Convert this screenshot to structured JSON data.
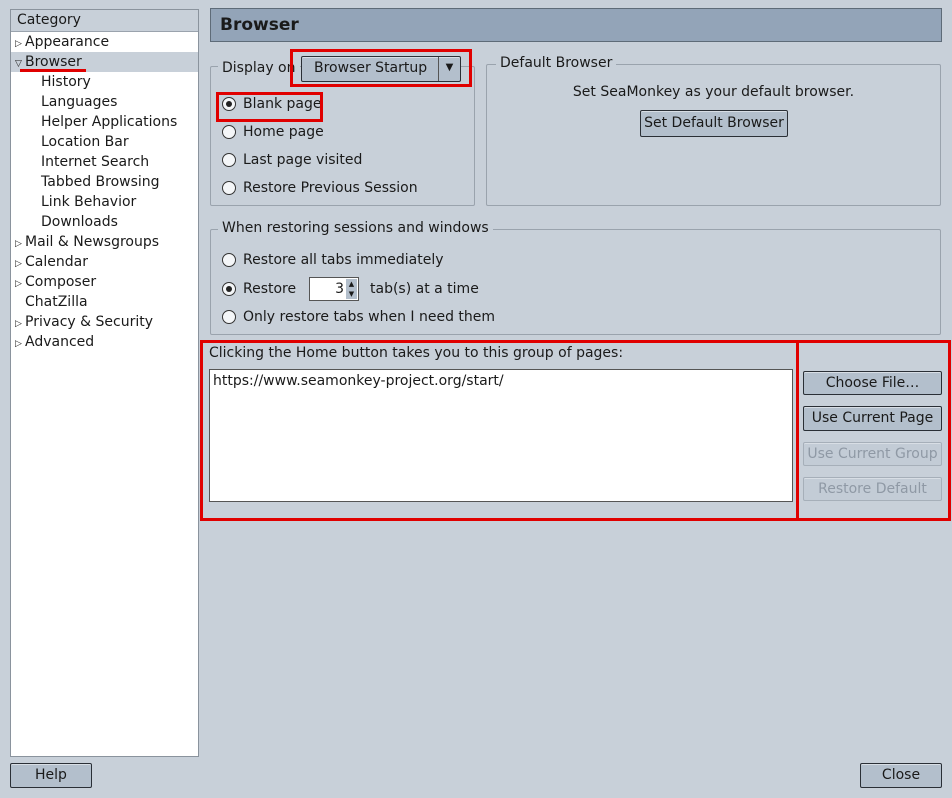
{
  "sidebar": {
    "header": "Category",
    "items": [
      {
        "label": "Appearance",
        "state": "collapsed"
      },
      {
        "label": "Browser",
        "state": "expanded",
        "selected": true
      },
      {
        "label": "History"
      },
      {
        "label": "Languages"
      },
      {
        "label": "Helper Applications"
      },
      {
        "label": "Location Bar"
      },
      {
        "label": "Internet Search"
      },
      {
        "label": "Tabbed Browsing"
      },
      {
        "label": "Link Behavior"
      },
      {
        "label": "Downloads"
      },
      {
        "label": "Mail & Newsgroups",
        "state": "collapsed"
      },
      {
        "label": "Calendar",
        "state": "collapsed"
      },
      {
        "label": "Composer",
        "state": "collapsed"
      },
      {
        "label": "ChatZilla"
      },
      {
        "label": "Privacy & Security",
        "state": "collapsed"
      },
      {
        "label": "Advanced",
        "state": "collapsed"
      }
    ]
  },
  "page_title": "Browser",
  "display_on": {
    "label": "Display on",
    "selected": "Browser Startup",
    "options": [
      {
        "label": "Blank page",
        "checked": true
      },
      {
        "label": "Home page",
        "checked": false
      },
      {
        "label": "Last page visited",
        "checked": false
      },
      {
        "label": "Restore Previous Session",
        "checked": false
      }
    ]
  },
  "default_browser": {
    "legend": "Default Browser",
    "text": "Set SeaMonkey as your default browser.",
    "button": "Set Default Browser"
  },
  "restore": {
    "legend": "When restoring sessions and windows",
    "opt1": "Restore all tabs immediately",
    "opt2_pre": "Restore",
    "opt2_value": "3",
    "opt2_post": "tab(s) at a time",
    "opt3": "Only restore tabs when I need them",
    "selected": 2
  },
  "home": {
    "label": "Clicking the Home button takes you to this group of pages:",
    "value": "https://www.seamonkey-project.org/start/",
    "buttons": {
      "choose": "Choose File…",
      "current_page": "Use Current Page",
      "current_group": "Use Current Group",
      "restore_default": "Restore Default"
    }
  },
  "footer": {
    "help": "Help",
    "close": "Close"
  },
  "colors": {
    "highlight": "#e00000",
    "background": "#c8d0d9",
    "title_bar": "#93a4b8"
  }
}
